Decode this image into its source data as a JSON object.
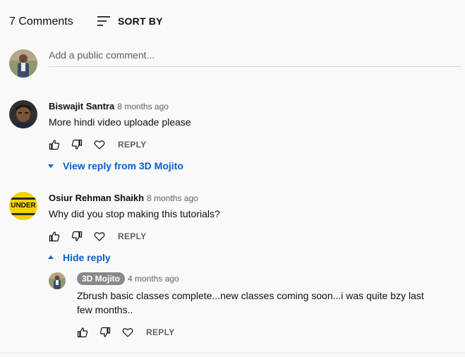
{
  "header": {
    "count_label": "7 Comments",
    "sort_label": "SORT BY",
    "sort_icon": "sort-lines-icon"
  },
  "add_comment": {
    "placeholder": "Add a public comment..."
  },
  "comments": [
    {
      "author": "Biswajit Santra",
      "time": "8 months ago",
      "text": "More hindi video uploade please",
      "reply_label": "REPLY",
      "toggle_label": "View reply from 3D Mojito"
    },
    {
      "author": "Osiur Rehman Shaikh",
      "time": "8 months ago",
      "text": "Why did you stop making this tutorials?",
      "reply_label": "REPLY",
      "toggle_label": "Hide reply",
      "avatar_logo_text": "UNDER",
      "replies": [
        {
          "author": "3D Mojito",
          "time": "4 months ago",
          "text_line1": "Zbrush basic classes complete...new classes coming soon...i was quite bzy last",
          "text_line2": "few months..",
          "reply_label": "REPLY"
        }
      ]
    }
  ],
  "colors": {
    "background": "#f9f9f9",
    "link_blue": "#065fd4",
    "secondary_text": "#606060",
    "owner_badge": "#888888"
  }
}
